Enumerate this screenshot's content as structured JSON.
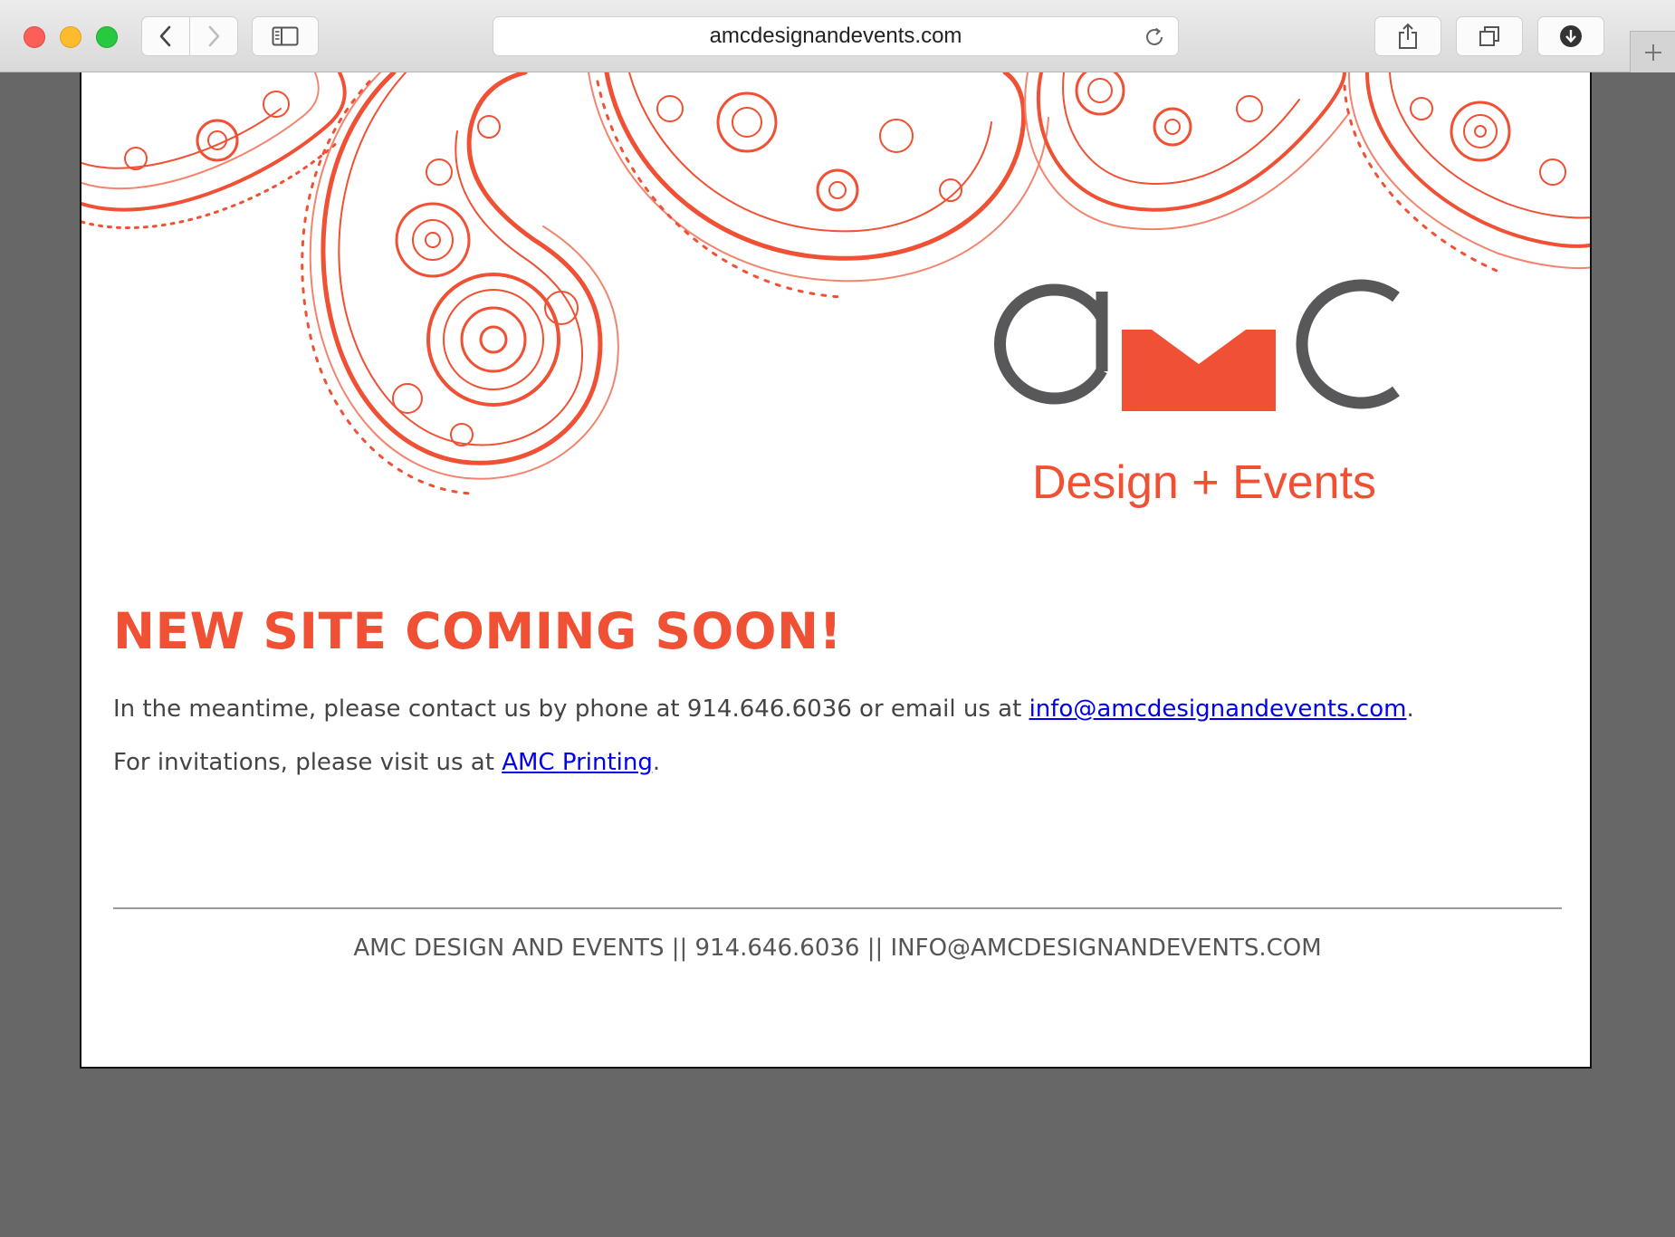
{
  "browser": {
    "url": "amcdesignandevents.com"
  },
  "brand": {
    "accent": "#f05033",
    "gray": "#58585b"
  },
  "logo": {
    "letters": "aMC",
    "tagline": "Design + Events"
  },
  "main": {
    "headline": "NEW SITE COMING SOON!",
    "para1_before": "In the meantime, please contact us by phone at 914.646.6036 or email us at ",
    "email_link": "info@amcdesignandevents.com",
    "para1_after": ".",
    "para2_before": "For invitations, please visit us at ",
    "printing_link": "AMC Printing",
    "para2_after": "."
  },
  "footer": {
    "text": "AMC DESIGN AND EVENTS || 914.646.6036 || INFO@AMCDESIGNANDEVENTS.COM"
  },
  "icons": [
    "chevron-left-icon",
    "chevron-right-icon",
    "sidebar-icon",
    "reload-icon",
    "share-icon",
    "tabs-icon",
    "download-icon",
    "plus-icon"
  ]
}
